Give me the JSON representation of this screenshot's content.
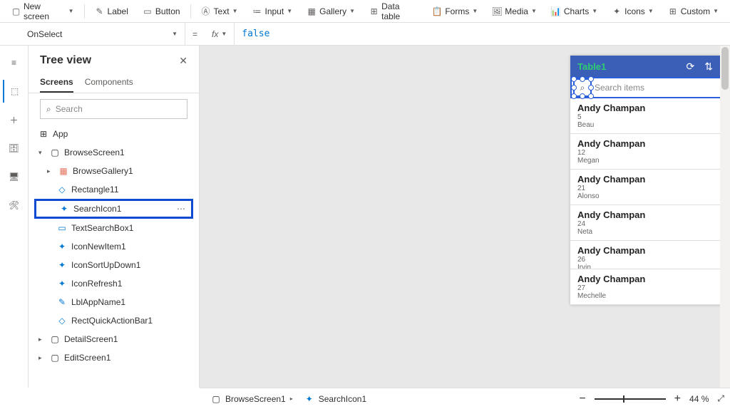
{
  "ribbon": {
    "new_screen": "New screen",
    "label": "Label",
    "button": "Button",
    "text": "Text",
    "input": "Input",
    "gallery": "Gallery",
    "datatable": "Data table",
    "forms": "Forms",
    "media": "Media",
    "charts": "Charts",
    "icons": "Icons",
    "custom": "Custom"
  },
  "formula": {
    "property": "OnSelect",
    "fx": "fx",
    "value": "false"
  },
  "panel": {
    "title": "Tree view",
    "tab_screens": "Screens",
    "tab_components": "Components",
    "search_ph": "Search"
  },
  "tree": {
    "app": "App",
    "browse_screen": "BrowseScreen1",
    "browse_gallery": "BrowseGallery1",
    "rectangle": "Rectangle11",
    "search_icon": "SearchIcon1",
    "text_search": "TextSearchBox1",
    "icon_new": "IconNewItem1",
    "icon_sort": "IconSortUpDown1",
    "icon_refresh": "IconRefresh1",
    "lbl_app": "LblAppName1",
    "rect_quick": "RectQuickActionBar1",
    "detail_screen": "DetailScreen1",
    "edit_screen": "EditScreen1"
  },
  "preview": {
    "title": "Table1",
    "search_ph": "Search items",
    "rows": [
      {
        "title": "Andy Champan",
        "sub1": "5",
        "sub2": "Beau"
      },
      {
        "title": "Andy Champan",
        "sub1": "12",
        "sub2": "Megan"
      },
      {
        "title": "Andy Champan",
        "sub1": "21",
        "sub2": "Alonso"
      },
      {
        "title": "Andy Champan",
        "sub1": "24",
        "sub2": "Neta"
      },
      {
        "title": "Andy Champan",
        "sub1": "26",
        "sub2": "Irvin"
      },
      {
        "title": "Andy Champan",
        "sub1": "27",
        "sub2": "Mechelle"
      }
    ]
  },
  "status": {
    "crumb1": "BrowseScreen1",
    "crumb2": "SearchIcon1",
    "zoom": "44",
    "zoom_unit": "%",
    "plus": "+",
    "minus": "−"
  }
}
